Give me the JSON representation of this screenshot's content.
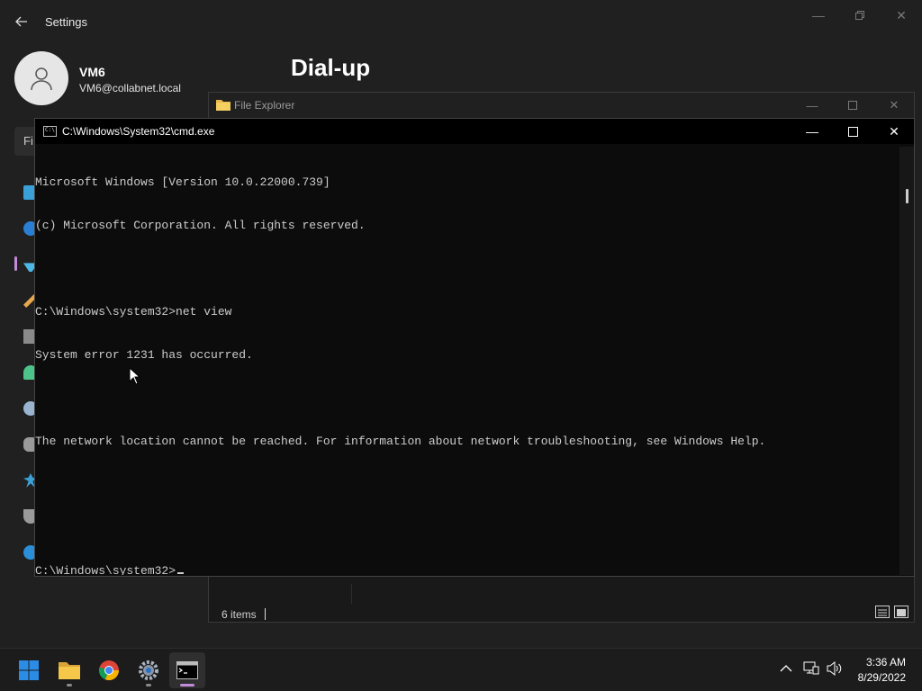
{
  "settings": {
    "window_title": "Settings",
    "back_icon": "back-arrow-icon",
    "user": {
      "name": "VM6",
      "email": "VM6@collabnet.local"
    },
    "page_title": "Dial-up",
    "find_placeholder": "Fi",
    "nav_icons": [
      "system-icon",
      "bluetooth-icon",
      "network-icon",
      "personalization-icon",
      "apps-icon",
      "accounts-icon",
      "time-language-icon",
      "gaming-icon",
      "accessibility-icon",
      "privacy-icon",
      "windows-update-icon"
    ],
    "accent_color": "#c28ad8"
  },
  "explorer": {
    "window_title": "File Explorer",
    "status_items": "6 items",
    "view_buttons": [
      "details-view-icon",
      "large-icons-view-icon"
    ]
  },
  "cmd": {
    "window_title": "C:\\Windows\\System32\\cmd.exe",
    "lines": [
      "Microsoft Windows [Version 10.0.22000.739]",
      "(c) Microsoft Corporation. All rights reserved.",
      "",
      "C:\\Windows\\system32>net view",
      "System error 1231 has occurred.",
      "",
      "The network location cannot be reached. For information about network troubleshooting, see Windows Help.",
      "",
      "",
      "C:\\Windows\\system32>"
    ]
  },
  "taskbar": {
    "apps": [
      "start-icon",
      "file-explorer-icon",
      "chrome-icon",
      "settings-icon",
      "cmd-icon"
    ],
    "time": "3:36 AM",
    "date": "8/29/2022"
  }
}
